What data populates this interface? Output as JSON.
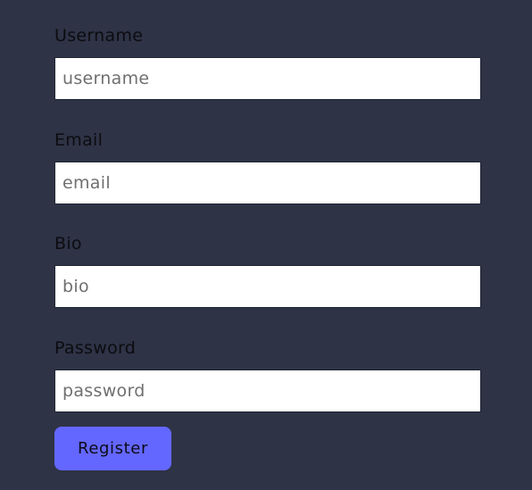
{
  "form": {
    "fields": [
      {
        "label": "Username",
        "placeholder": "username",
        "value": ""
      },
      {
        "label": "Email",
        "placeholder": "email",
        "value": ""
      },
      {
        "label": "Bio",
        "placeholder": "bio",
        "value": ""
      },
      {
        "label": "Password",
        "placeholder": "password",
        "value": ""
      }
    ],
    "submit_label": "Register"
  },
  "colors": {
    "background": "#2e3346",
    "button": "#6467ff",
    "input_background": "#ffffff"
  }
}
